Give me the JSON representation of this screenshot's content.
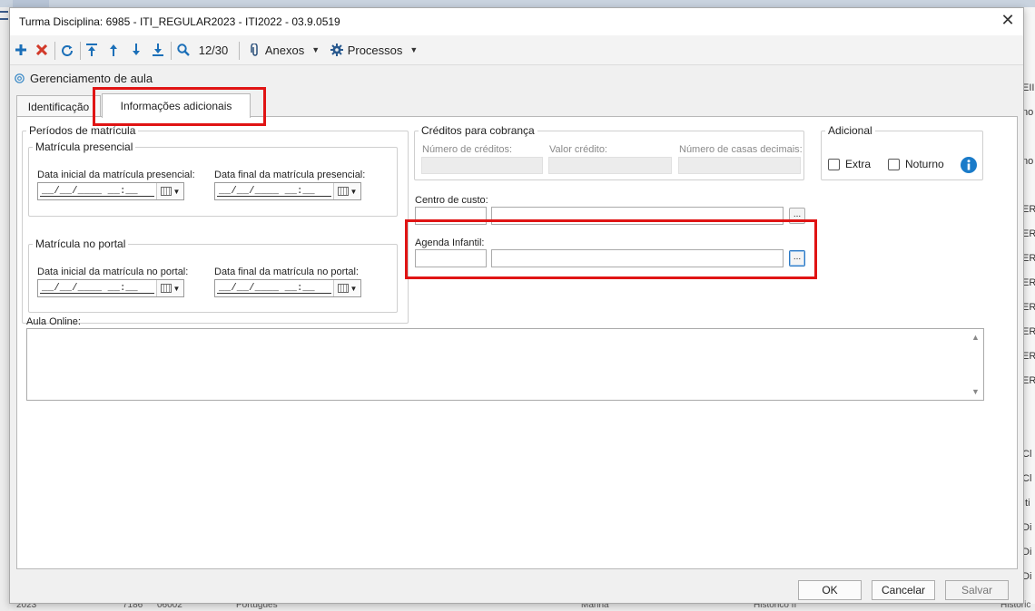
{
  "background": {
    "right_fragments": [
      "EII",
      "no",
      "no",
      "ERA",
      "ERA",
      "ERA",
      "ERA",
      "ERA",
      "ERA",
      "ERA",
      "ERA",
      "Cl",
      "Cl",
      "Iti",
      "Di",
      "Di",
      "Di"
    ],
    "bottom_fragments": [
      "2023",
      "7186",
      "06002",
      "Portugues",
      "Manha",
      "Historico II",
      "Historic"
    ]
  },
  "dialog": {
    "title": "Turma Disciplina: 6985 - ITI_REGULAR2023 - ITI2022 - 03.9.0519",
    "close_glyph": "✕"
  },
  "toolbar": {
    "record_counter": "12/30",
    "anexos_label": "Anexos",
    "processos_label": "Processos"
  },
  "breadcrumb": {
    "label": "Gerenciamento de aula"
  },
  "tabs": [
    {
      "label": "Identificação"
    },
    {
      "label": "Informações adicionais"
    }
  ],
  "periodos": {
    "legend": "Períodos de matrícula",
    "presencial": {
      "legend": "Matrícula presencial",
      "start_label": "Data inicial da matrícula presencial:",
      "end_label": "Data final da matrícula presencial:",
      "start_value": "__/__/____ __:__",
      "end_value": "__/__/____ __:__"
    },
    "portal": {
      "legend": "Matrícula no portal",
      "start_label": "Data inicial da matrícula no portal:",
      "end_label": "Data final da matrícula no portal:",
      "start_value": "__/__/____ __:__",
      "end_value": "__/__/____ __:__"
    }
  },
  "creditos": {
    "legend": "Créditos para cobrança",
    "numero_label": "Número de créditos:",
    "valor_label": "Valor crédito:",
    "casas_label": "Número de casas decimais:"
  },
  "adicional": {
    "legend": "Adicional",
    "extra_label": "Extra",
    "noturno_label": "Noturno"
  },
  "centro_custo": {
    "label": "Centro de custo:",
    "button": "..."
  },
  "agenda_infantil": {
    "label": "Agenda Infantil:",
    "button": "..."
  },
  "aula_online": {
    "label": "Aula Online:"
  },
  "footer": {
    "ok": "OK",
    "cancel": "Cancelar",
    "save": "Salvar"
  },
  "colors": {
    "highlight": "#e01414",
    "info": "#1a7bc9",
    "remove": "#d23a2a",
    "add": "#1b6fb8"
  }
}
